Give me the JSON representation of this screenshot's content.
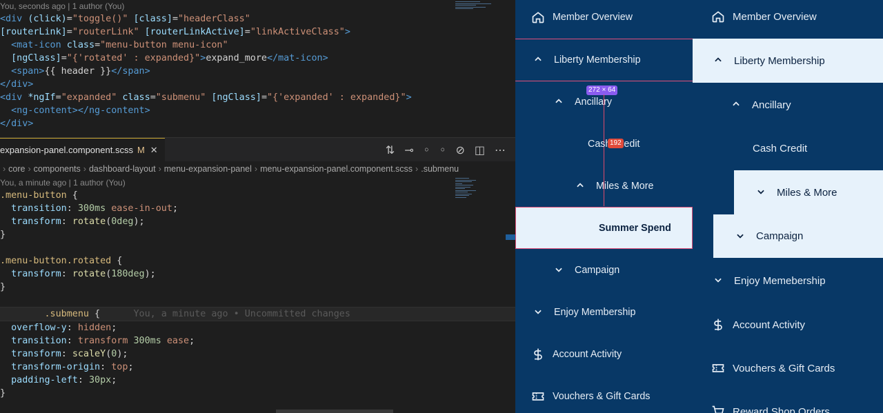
{
  "editor": {
    "top_blame": "You, seconds ago | 1 author (You)",
    "html_lines": [
      [
        [
          "t-tag",
          "<div "
        ],
        [
          "t-attr",
          "(click)"
        ],
        [
          "t-txt",
          "="
        ],
        [
          "t-str",
          "\"toggle()\""
        ],
        [
          "t-txt",
          " "
        ],
        [
          "t-attr",
          "[class]"
        ],
        [
          "t-txt",
          "="
        ],
        [
          "t-str",
          "\"headerClass\""
        ]
      ],
      [
        [
          "t-attr",
          "[routerLink]"
        ],
        [
          "t-txt",
          "="
        ],
        [
          "t-str",
          "\"routerLink\""
        ],
        [
          "t-txt",
          " "
        ],
        [
          "t-attr",
          "[routerLinkActive]"
        ],
        [
          "t-txt",
          "="
        ],
        [
          "t-str",
          "\"linkActiveClass\""
        ],
        [
          "t-tag",
          ">"
        ]
      ],
      [
        [
          "t-txt",
          "  "
        ],
        [
          "t-tag",
          "<mat-icon "
        ],
        [
          "t-attr",
          "class"
        ],
        [
          "t-txt",
          "="
        ],
        [
          "t-str",
          "\"menu-button menu-icon\""
        ]
      ],
      [
        [
          "t-txt",
          "  "
        ],
        [
          "t-attr",
          "[ngClass]"
        ],
        [
          "t-txt",
          "="
        ],
        [
          "t-str",
          "\"{"
        ],
        [
          "t-kw",
          "'rotated'"
        ],
        [
          "t-str",
          " : expanded}\""
        ],
        [
          "t-tag",
          ">"
        ],
        [
          "t-txt",
          "expand_more"
        ],
        [
          "t-tag",
          "</mat-icon>"
        ]
      ],
      [
        [
          "t-txt",
          "  "
        ],
        [
          "t-tag",
          "<span>"
        ],
        [
          "t-txt",
          "{{ header }}"
        ],
        [
          "t-tag",
          "</span>"
        ]
      ],
      [
        [
          "t-tag",
          "</div>"
        ]
      ],
      [
        [
          "t-tag",
          "<div "
        ],
        [
          "t-attr",
          "*ngIf"
        ],
        [
          "t-txt",
          "="
        ],
        [
          "t-str",
          "\"expanded\""
        ],
        [
          "t-txt",
          " "
        ],
        [
          "t-attr",
          "class"
        ],
        [
          "t-txt",
          "="
        ],
        [
          "t-str",
          "\"submenu\""
        ],
        [
          "t-txt",
          " "
        ],
        [
          "t-attr",
          "[ngClass]"
        ],
        [
          "t-txt",
          "="
        ],
        [
          "t-str",
          "\"{"
        ],
        [
          "t-kw",
          "'expanded'"
        ],
        [
          "t-str",
          " : expanded}\""
        ],
        [
          "t-tag",
          ">"
        ]
      ],
      [
        [
          "t-txt",
          "  "
        ],
        [
          "t-tag",
          "<ng-content></ng-content>"
        ]
      ],
      [
        [
          "t-tag",
          "</div>"
        ]
      ]
    ],
    "tab_label": "expansion-panel.component.scss",
    "tab_modified": "M",
    "tab_close": "✕",
    "tab_icons": [
      "⇅",
      "⊸",
      "◦",
      "◦",
      "⊘",
      "◫",
      "⋯"
    ],
    "breadcrumbs": [
      "core",
      "components",
      "dashboard-layout",
      "menu-expansion-panel",
      "menu-expansion-panel.component.scss",
      ".submenu"
    ],
    "scss_blame": "You, a minute ago | 1 author (You)",
    "scss_lines": [
      [
        [
          "t-sel",
          ".menu-button"
        ],
        [
          "t-txt",
          " {"
        ]
      ],
      [
        [
          "t-txt",
          "  "
        ],
        [
          "t-prop",
          "transition"
        ],
        [
          "t-txt",
          ": "
        ],
        [
          "t-num",
          "300ms"
        ],
        [
          "t-txt",
          " "
        ],
        [
          "t-kw",
          "ease-in-out"
        ],
        [
          "t-txt",
          ";"
        ]
      ],
      [
        [
          "t-txt",
          "  "
        ],
        [
          "t-prop",
          "transform"
        ],
        [
          "t-txt",
          ": "
        ],
        [
          "t-fn",
          "rotate"
        ],
        [
          "t-txt",
          "("
        ],
        [
          "t-num",
          "0deg"
        ],
        [
          "t-txt",
          ");"
        ]
      ],
      [
        [
          "t-txt",
          "}"
        ]
      ],
      [
        [
          "t-txt",
          ""
        ]
      ],
      [
        [
          "t-sel",
          ".menu-button.rotated"
        ],
        [
          "t-txt",
          " {"
        ]
      ],
      [
        [
          "t-txt",
          "  "
        ],
        [
          "t-prop",
          "transform"
        ],
        [
          "t-txt",
          ": "
        ],
        [
          "t-fn",
          "rotate"
        ],
        [
          "t-txt",
          "("
        ],
        [
          "t-num",
          "180deg"
        ],
        [
          "t-txt",
          ");"
        ]
      ],
      [
        [
          "t-txt",
          "}"
        ]
      ],
      [
        [
          "t-txt",
          ""
        ]
      ],
      [
        [
          "t-txt",
          "        "
        ],
        [
          "t-sel",
          ".submenu"
        ],
        [
          "t-txt",
          " {      "
        ],
        [
          "t-ghost",
          "You, a minute ago • Uncommitted changes"
        ]
      ],
      [
        [
          "t-txt",
          "  "
        ],
        [
          "t-prop",
          "overflow-y"
        ],
        [
          "t-txt",
          ": "
        ],
        [
          "t-kw",
          "hidden"
        ],
        [
          "t-txt",
          ";"
        ]
      ],
      [
        [
          "t-txt",
          "  "
        ],
        [
          "t-prop",
          "transition"
        ],
        [
          "t-txt",
          ": "
        ],
        [
          "t-kw",
          "transform"
        ],
        [
          "t-txt",
          " "
        ],
        [
          "t-num",
          "300ms"
        ],
        [
          "t-txt",
          " "
        ],
        [
          "t-kw",
          "ease"
        ],
        [
          "t-txt",
          ";"
        ]
      ],
      [
        [
          "t-txt",
          "  "
        ],
        [
          "t-prop",
          "transform"
        ],
        [
          "t-txt",
          ": "
        ],
        [
          "t-fn",
          "scaleY"
        ],
        [
          "t-txt",
          "("
        ],
        [
          "t-num",
          "0"
        ],
        [
          "t-txt",
          ");"
        ]
      ],
      [
        [
          "t-txt",
          "  "
        ],
        [
          "t-prop",
          "transform-origin"
        ],
        [
          "t-txt",
          ": "
        ],
        [
          "t-kw",
          "top"
        ],
        [
          "t-txt",
          ";"
        ]
      ],
      [
        [
          "t-txt",
          "  "
        ],
        [
          "t-prop",
          "padding-left"
        ],
        [
          "t-txt",
          ": "
        ],
        [
          "t-num",
          "30px"
        ],
        [
          "t-txt",
          ";"
        ]
      ],
      [
        [
          "t-txt",
          "}"
        ]
      ]
    ]
  },
  "devtools": {
    "size_badge": "272 × 64",
    "measure_badge": "192"
  },
  "nav_left": {
    "items": [
      "Member Overview",
      "Liberty Membership",
      "Ancillary",
      "Cash Credit",
      "Miles & More",
      "Summer Spend",
      "Campaign",
      "Enjoy Membership",
      "Account Activity",
      "Vouchers & Gift Cards"
    ]
  },
  "nav_right": {
    "items": [
      "Member Overview",
      "Liberty Membership",
      "Ancillary",
      "Cash Credit",
      "Miles & More",
      "Campaign",
      "Enjoy Memebership",
      "Account Activity",
      "Vouchers & Gift Cards",
      "Reward Shop Orders"
    ]
  },
  "colors": {
    "nav_bg": "#083866",
    "highlight_bg": "#e7f2fb",
    "selection": "#e0507a"
  },
  "icons": {
    "home": "home-icon",
    "chevron_up": "chevron-up-icon",
    "chevron_down": "chevron-down-icon",
    "dollar": "dollar-icon",
    "ticket": "ticket-icon",
    "cart": "cart-icon"
  }
}
